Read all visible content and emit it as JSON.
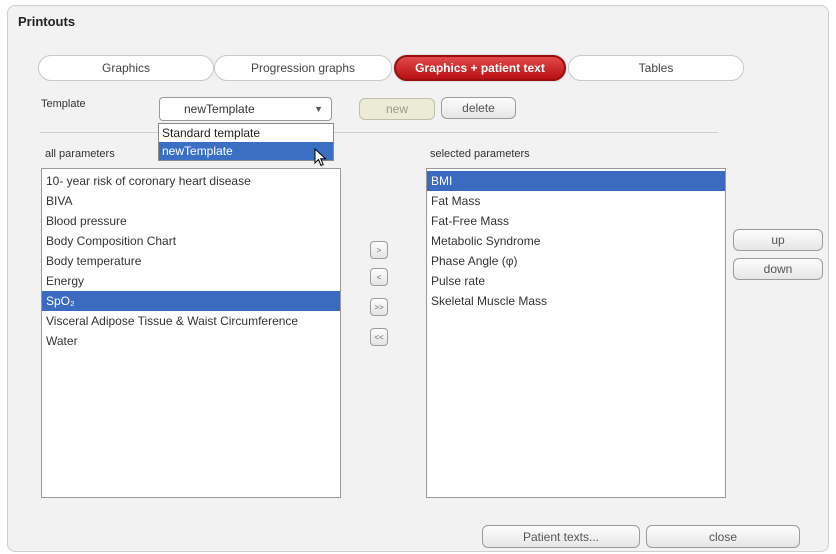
{
  "window": {
    "title": "Printouts"
  },
  "tabs": [
    {
      "label": "Graphics"
    },
    {
      "label": "Progression graphs"
    },
    {
      "label": "Graphics + patient text"
    },
    {
      "label": "Tables"
    }
  ],
  "template": {
    "label": "Template",
    "selected": "newTemplate",
    "options": [
      "Standard template",
      "newTemplate"
    ],
    "new_label": "new",
    "delete_label": "delete"
  },
  "all_parameters": {
    "header": "all parameters",
    "items": [
      "10- year risk of coronary heart disease",
      "BIVA",
      "Blood pressure",
      "Body Composition Chart",
      "Body temperature",
      "Energy",
      "SpO₂",
      "Visceral Adipose Tissue & Waist Circumference",
      "Water"
    ],
    "selected_index": 6
  },
  "transfer_buttons": {
    "add": ">",
    "remove": "<",
    "add_all": ">>",
    "remove_all": "<<"
  },
  "selected_parameters": {
    "header": "selected parameters",
    "items": [
      "BMI",
      "Fat Mass",
      "Fat-Free Mass",
      "Metabolic Syndrome",
      "Phase Angle (φ)",
      "Pulse rate",
      "Skeletal Muscle Mass"
    ],
    "selected_index": 0
  },
  "order_buttons": {
    "up": "up",
    "down": "down"
  },
  "footer": {
    "patient_texts": "Patient texts...",
    "close": "close"
  }
}
